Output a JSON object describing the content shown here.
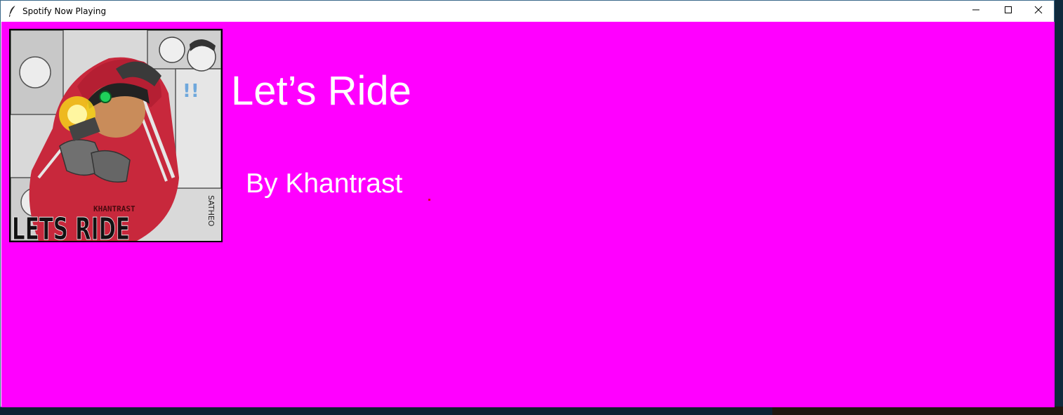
{
  "window": {
    "title": "Spotify Now Playing",
    "app_icon": "feather-icon",
    "controls": {
      "minimize": "minimize-icon",
      "maximize": "maximize-icon",
      "close": "close-icon"
    }
  },
  "now_playing": {
    "track_title": "Let’s Ride",
    "artist_line": "By Khantrast",
    "background_color": "#ff00ff",
    "text_color": "#ffffff",
    "album_art": {
      "cover_text": "LETS RIDE",
      "artist_text": "KHANTRAST",
      "signature": "SATHEO"
    }
  }
}
